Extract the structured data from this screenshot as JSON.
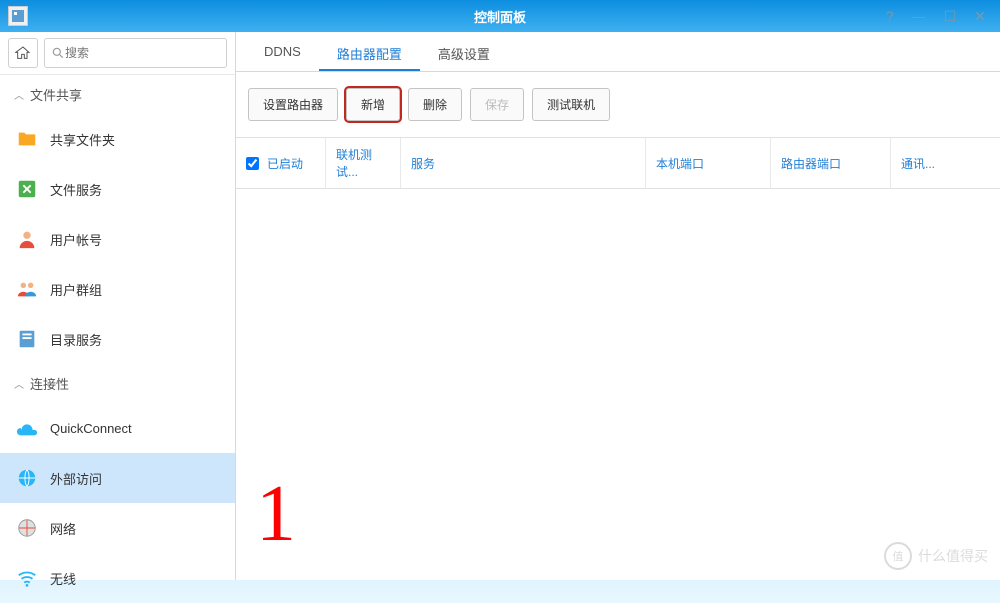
{
  "titlebar": {
    "title": "控制面板"
  },
  "search": {
    "placeholder": "搜索"
  },
  "sections": {
    "fileshare": {
      "label": "文件共享"
    },
    "connectivity": {
      "label": "连接性"
    }
  },
  "nav": {
    "shared_folder": "共享文件夹",
    "file_services": "文件服务",
    "user_account": "用户帐号",
    "user_group": "用户群组",
    "directory_service": "目录服务",
    "quickconnect": "QuickConnect",
    "external_access": "外部访问",
    "network": "网络",
    "wireless": "无线"
  },
  "tabs": {
    "ddns": "DDNS",
    "router_config": "路由器配置",
    "advanced": "高级设置"
  },
  "toolbar": {
    "setup_router": "设置路由器",
    "add": "新增",
    "delete": "删除",
    "save": "保存",
    "test_connection": "测试联机"
  },
  "columns": {
    "enabled": "已启动",
    "connection_test": "联机测试...",
    "service": "服务",
    "local_port": "本机端口",
    "router_port": "路由器端口",
    "protocol": "通讯..."
  },
  "annotation": {
    "number": "1"
  },
  "watermark": {
    "circle": "值",
    "text": "什么值得买"
  }
}
